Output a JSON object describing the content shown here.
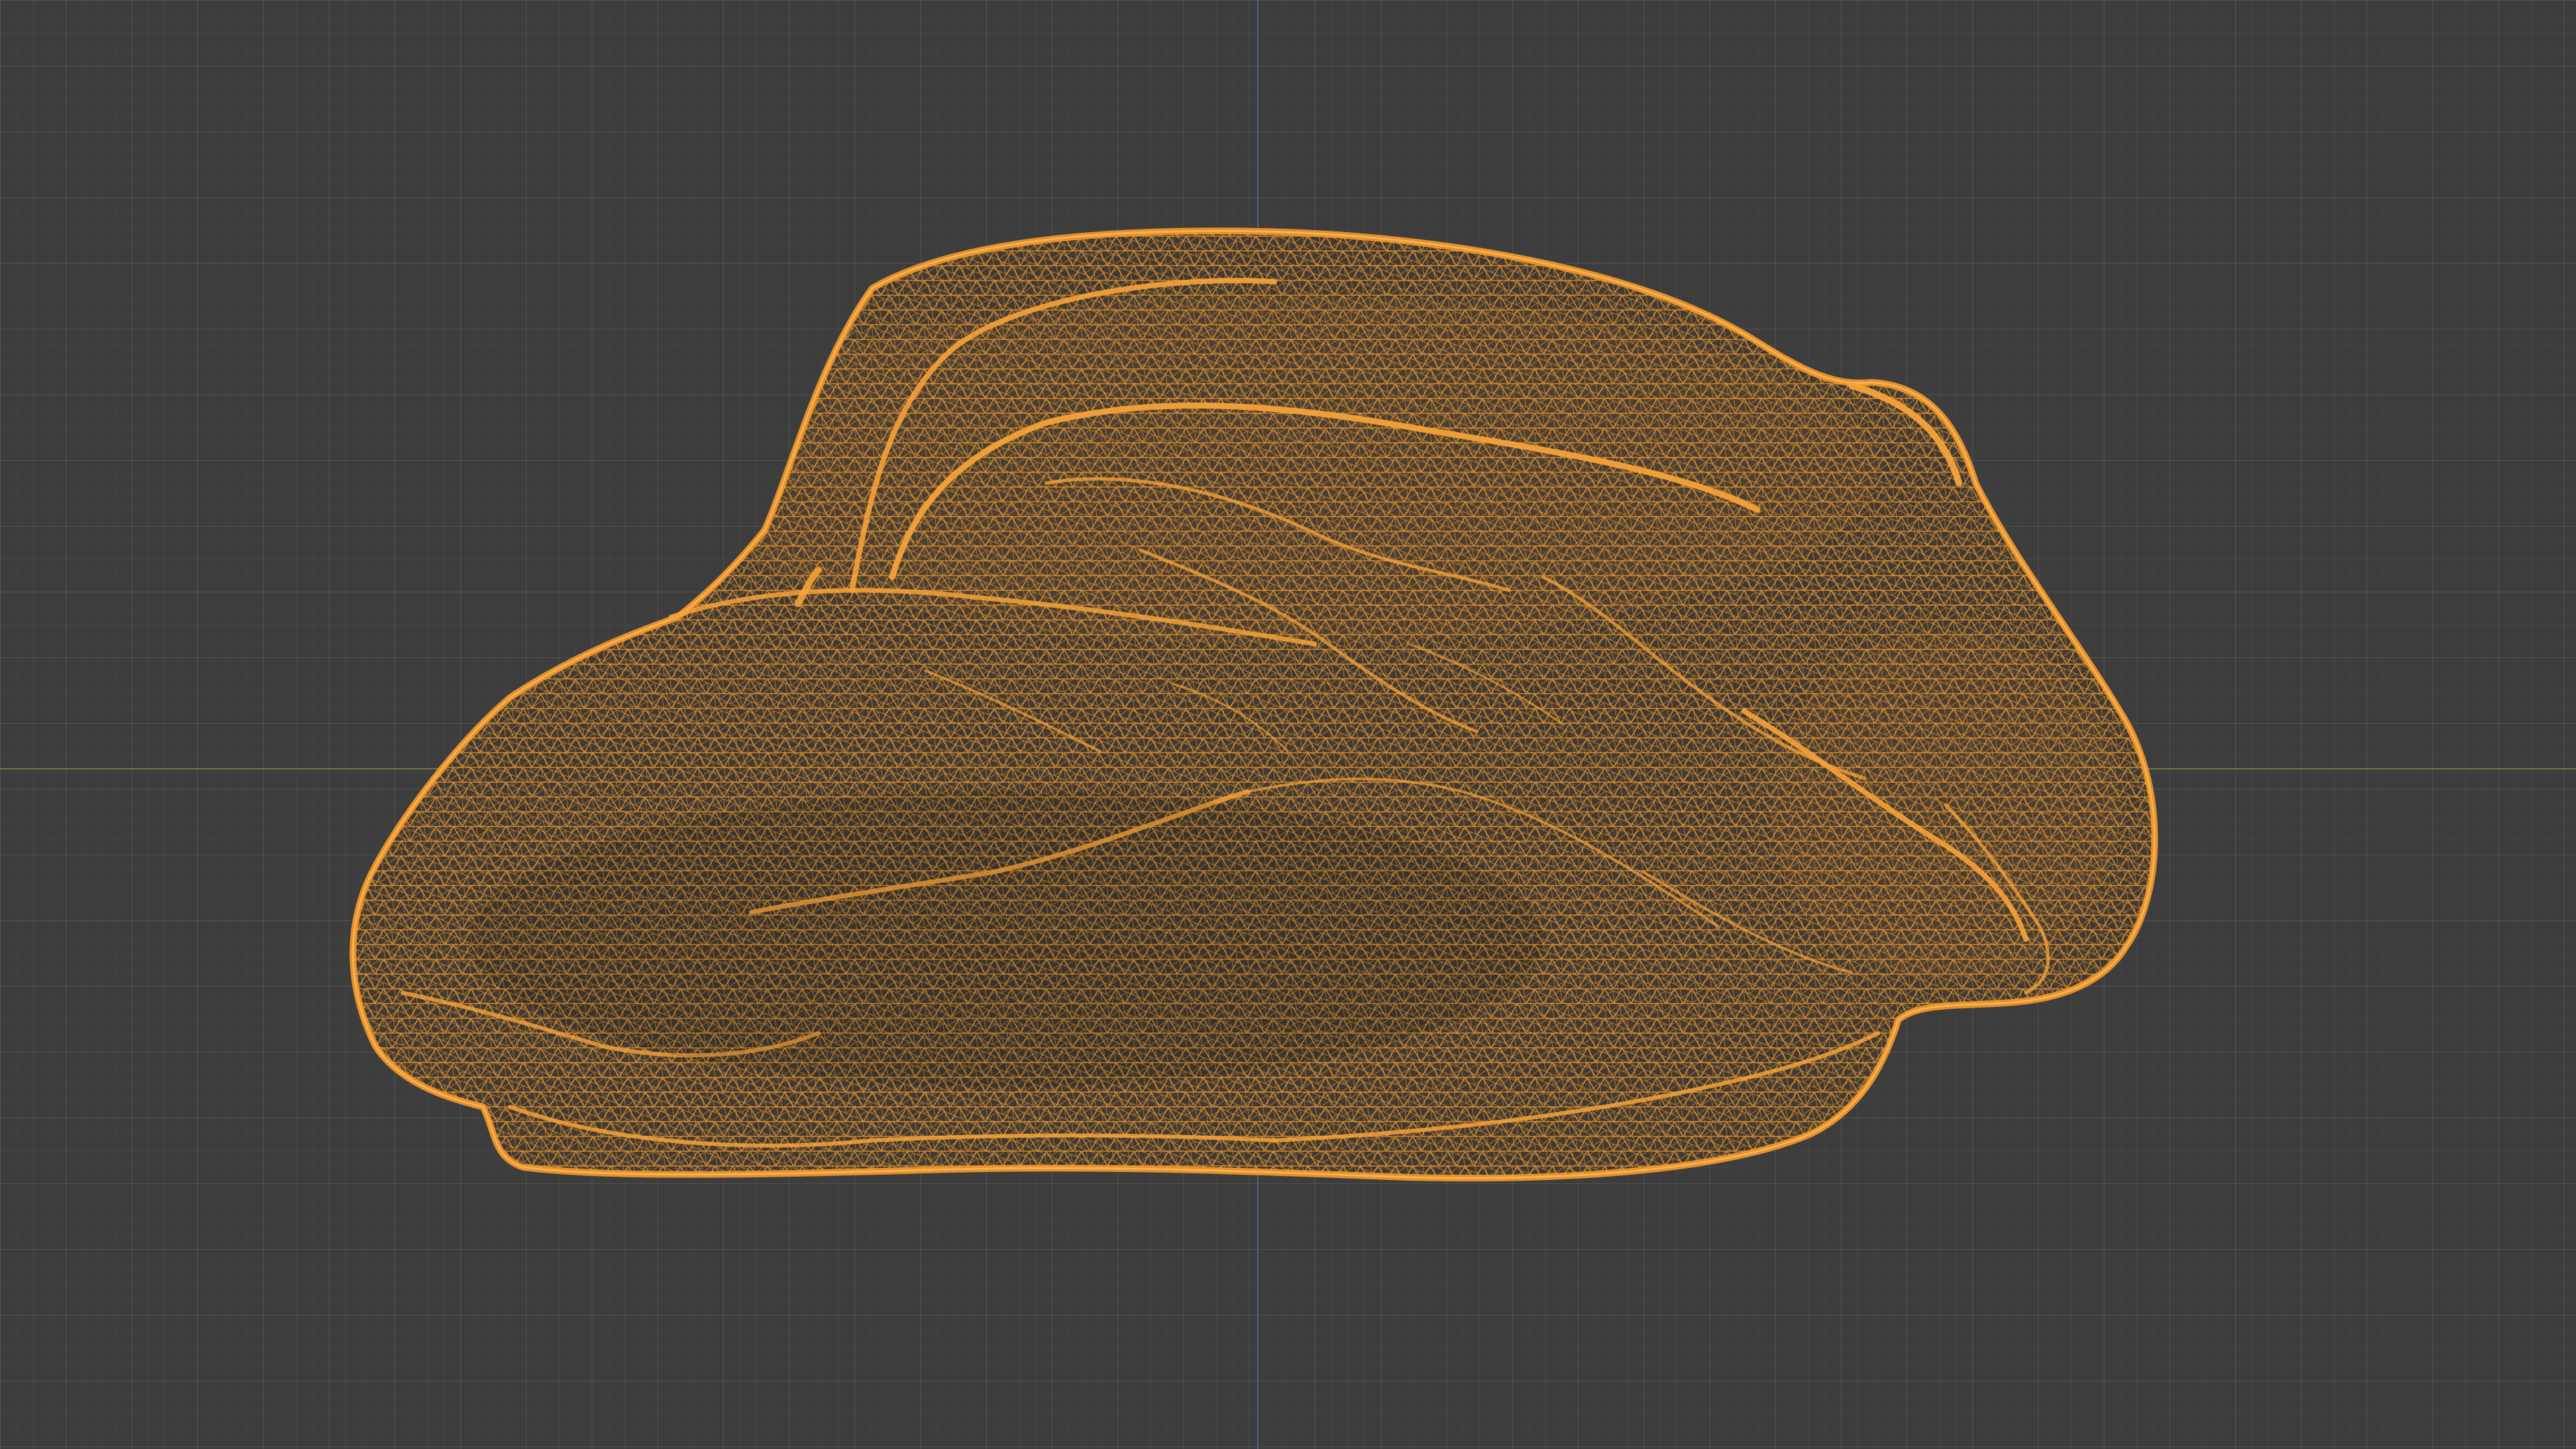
{
  "viewport": {
    "label": "",
    "background_color": "#3d3d3d",
    "grid_color": "#474747",
    "x_axis_color": "#6b7a3c",
    "z_axis_color": "#4a5f8a"
  },
  "object": {
    "name": "",
    "display_mode": "wireframe",
    "wire_color": "#f29a2e",
    "selected": true
  }
}
